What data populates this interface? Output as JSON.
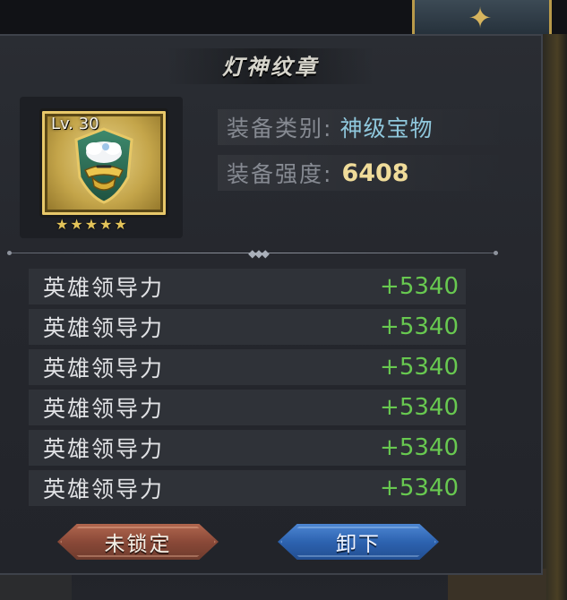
{
  "dialog": {
    "title": "灯神纹章"
  },
  "item": {
    "level_label": "Lv. 30",
    "star_count": 5,
    "stars_text": "★★★★★",
    "icon": "genie-lamp-emblem-icon"
  },
  "info": {
    "type_label": "装备类别:",
    "type_value": "神级宝物",
    "power_label": "装备强度:",
    "power_value": "6408"
  },
  "stats": [
    {
      "name": "英雄领导力",
      "value": "+5340"
    },
    {
      "name": "英雄领导力",
      "value": "+5340"
    },
    {
      "name": "英雄领导力",
      "value": "+5340"
    },
    {
      "name": "英雄领导力",
      "value": "+5340"
    },
    {
      "name": "英雄领导力",
      "value": "+5340"
    },
    {
      "name": "英雄领导力",
      "value": "+5340"
    }
  ],
  "buttons": {
    "lock_label": "未锁定",
    "unequip_label": "卸下"
  },
  "colors": {
    "stat_value": "#68c950",
    "type_value": "#8fc7dc",
    "power_value": "#f0dc9a",
    "lock_button": "#8a4938",
    "unequip_button": "#2d63b0"
  }
}
